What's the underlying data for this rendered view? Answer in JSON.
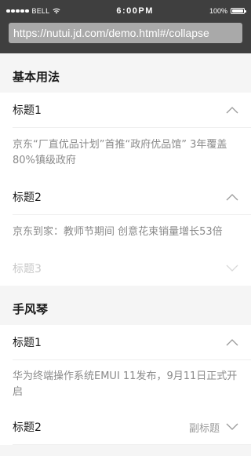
{
  "status_bar": {
    "carrier": "BELL",
    "time": "6:00PM",
    "battery": "100%"
  },
  "url_bar": {
    "url": "https://nutui.jd.com/demo.html#/collapse"
  },
  "sections": [
    {
      "title": "基本用法",
      "items": [
        {
          "title": "标题1",
          "expanded": true,
          "content": "京东“厂直优品计划”首推“政府优品馆” 3年覆盖80%镇级政府"
        },
        {
          "title": "标题2",
          "expanded": true,
          "content": "京东到家：教师节期间 创意花束销量增长53倍"
        },
        {
          "title": "标题3",
          "expanded": false,
          "disabled": true
        }
      ]
    },
    {
      "title": "手风琴",
      "items": [
        {
          "title": "标题1",
          "expanded": true,
          "content": "华为终端操作系统EMUI 11发布，9月11日正式开启"
        },
        {
          "title": "标题2",
          "expanded": false,
          "subtitle": "副标题"
        }
      ]
    }
  ],
  "colors": {
    "chrome_bg": "#3f3f3f",
    "url_bar_bg": "#a9a9a9",
    "page_bg": "#f5f5f5",
    "text_primary": "#1a1a1a",
    "text_secondary": "#8a8a8a",
    "text_disabled": "#c8c8c8"
  },
  "icons": [
    "signal-dots-icon",
    "wifi-icon",
    "battery-icon",
    "chevron-up-icon",
    "chevron-down-icon"
  ]
}
